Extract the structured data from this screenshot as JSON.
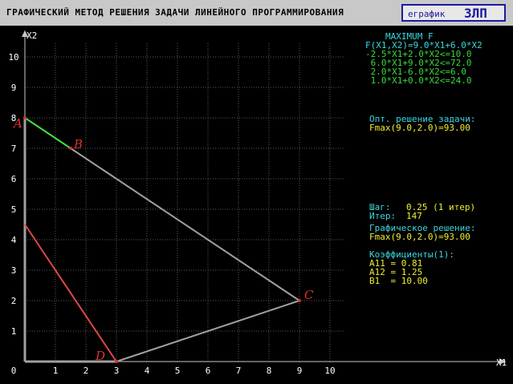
{
  "window": {
    "title": "ГРАФИЧЕСКИЙ МЕТОД РЕШЕНИЯ ЗАДАЧИ ЛИНЕЙНОГО ПРОГРАММИРОВАНИЯ",
    "box_label": "еграфик",
    "box_big": "ЗЛП"
  },
  "axes": {
    "x_label": "X1",
    "y_label": "X2",
    "x_ticks": [
      "0",
      "1",
      "2",
      "3",
      "4",
      "5",
      "6",
      "7",
      "8",
      "9",
      "10"
    ],
    "y_ticks": [
      "1",
      "2",
      "3",
      "4",
      "5",
      "6",
      "7",
      "8",
      "9",
      "10"
    ]
  },
  "vertices": [
    {
      "name": "A",
      "x": 0,
      "y": 8
    },
    {
      "name": "B",
      "x": 1.5,
      "y": 7
    },
    {
      "name": "C",
      "x": 9,
      "y": 2
    },
    {
      "name": "D",
      "x": 3,
      "y": 0
    }
  ],
  "panel": {
    "header": "MAXIMUM F",
    "objective": "F(X1,X2)=9.0*X1+6.0*X2",
    "constraints": [
      "-2.5*X1+2.0*X2<=10.0",
      " 6.0*X1+9.0*X2<=72.0",
      " 2.0*X1-6.0*X2<=6.0",
      " 1.0*X1+0.0*X2<=24.0"
    ],
    "solution_label": "Опт. решение задачи:",
    "solution_value": "Fmax(9.0,2.0)=93.00",
    "step_label": "Шаг:",
    "step_value": "0.25 (1 итер)",
    "iter_label": "Итер:",
    "iter_value": "147",
    "graphic_label": "Графическое решение:",
    "graphic_value": "Fmax(9.0,2.0)=93.00",
    "coef_label": "Коэффициенты(1):",
    "coef_lines": [
      "A11 = 0.81",
      "A12 = 1.25",
      "B1  = 10.00"
    ]
  },
  "colors": {
    "axis": "#c8c8c8",
    "grid": "#5a5a5a",
    "feasible": "#a0a0a0",
    "edge_ab": "#40e040",
    "line_red": "#e04848",
    "label_red": "#e03030",
    "cyan": "#3cd8e0",
    "green": "#3cd83c",
    "yellow": "#f0f030"
  }
}
